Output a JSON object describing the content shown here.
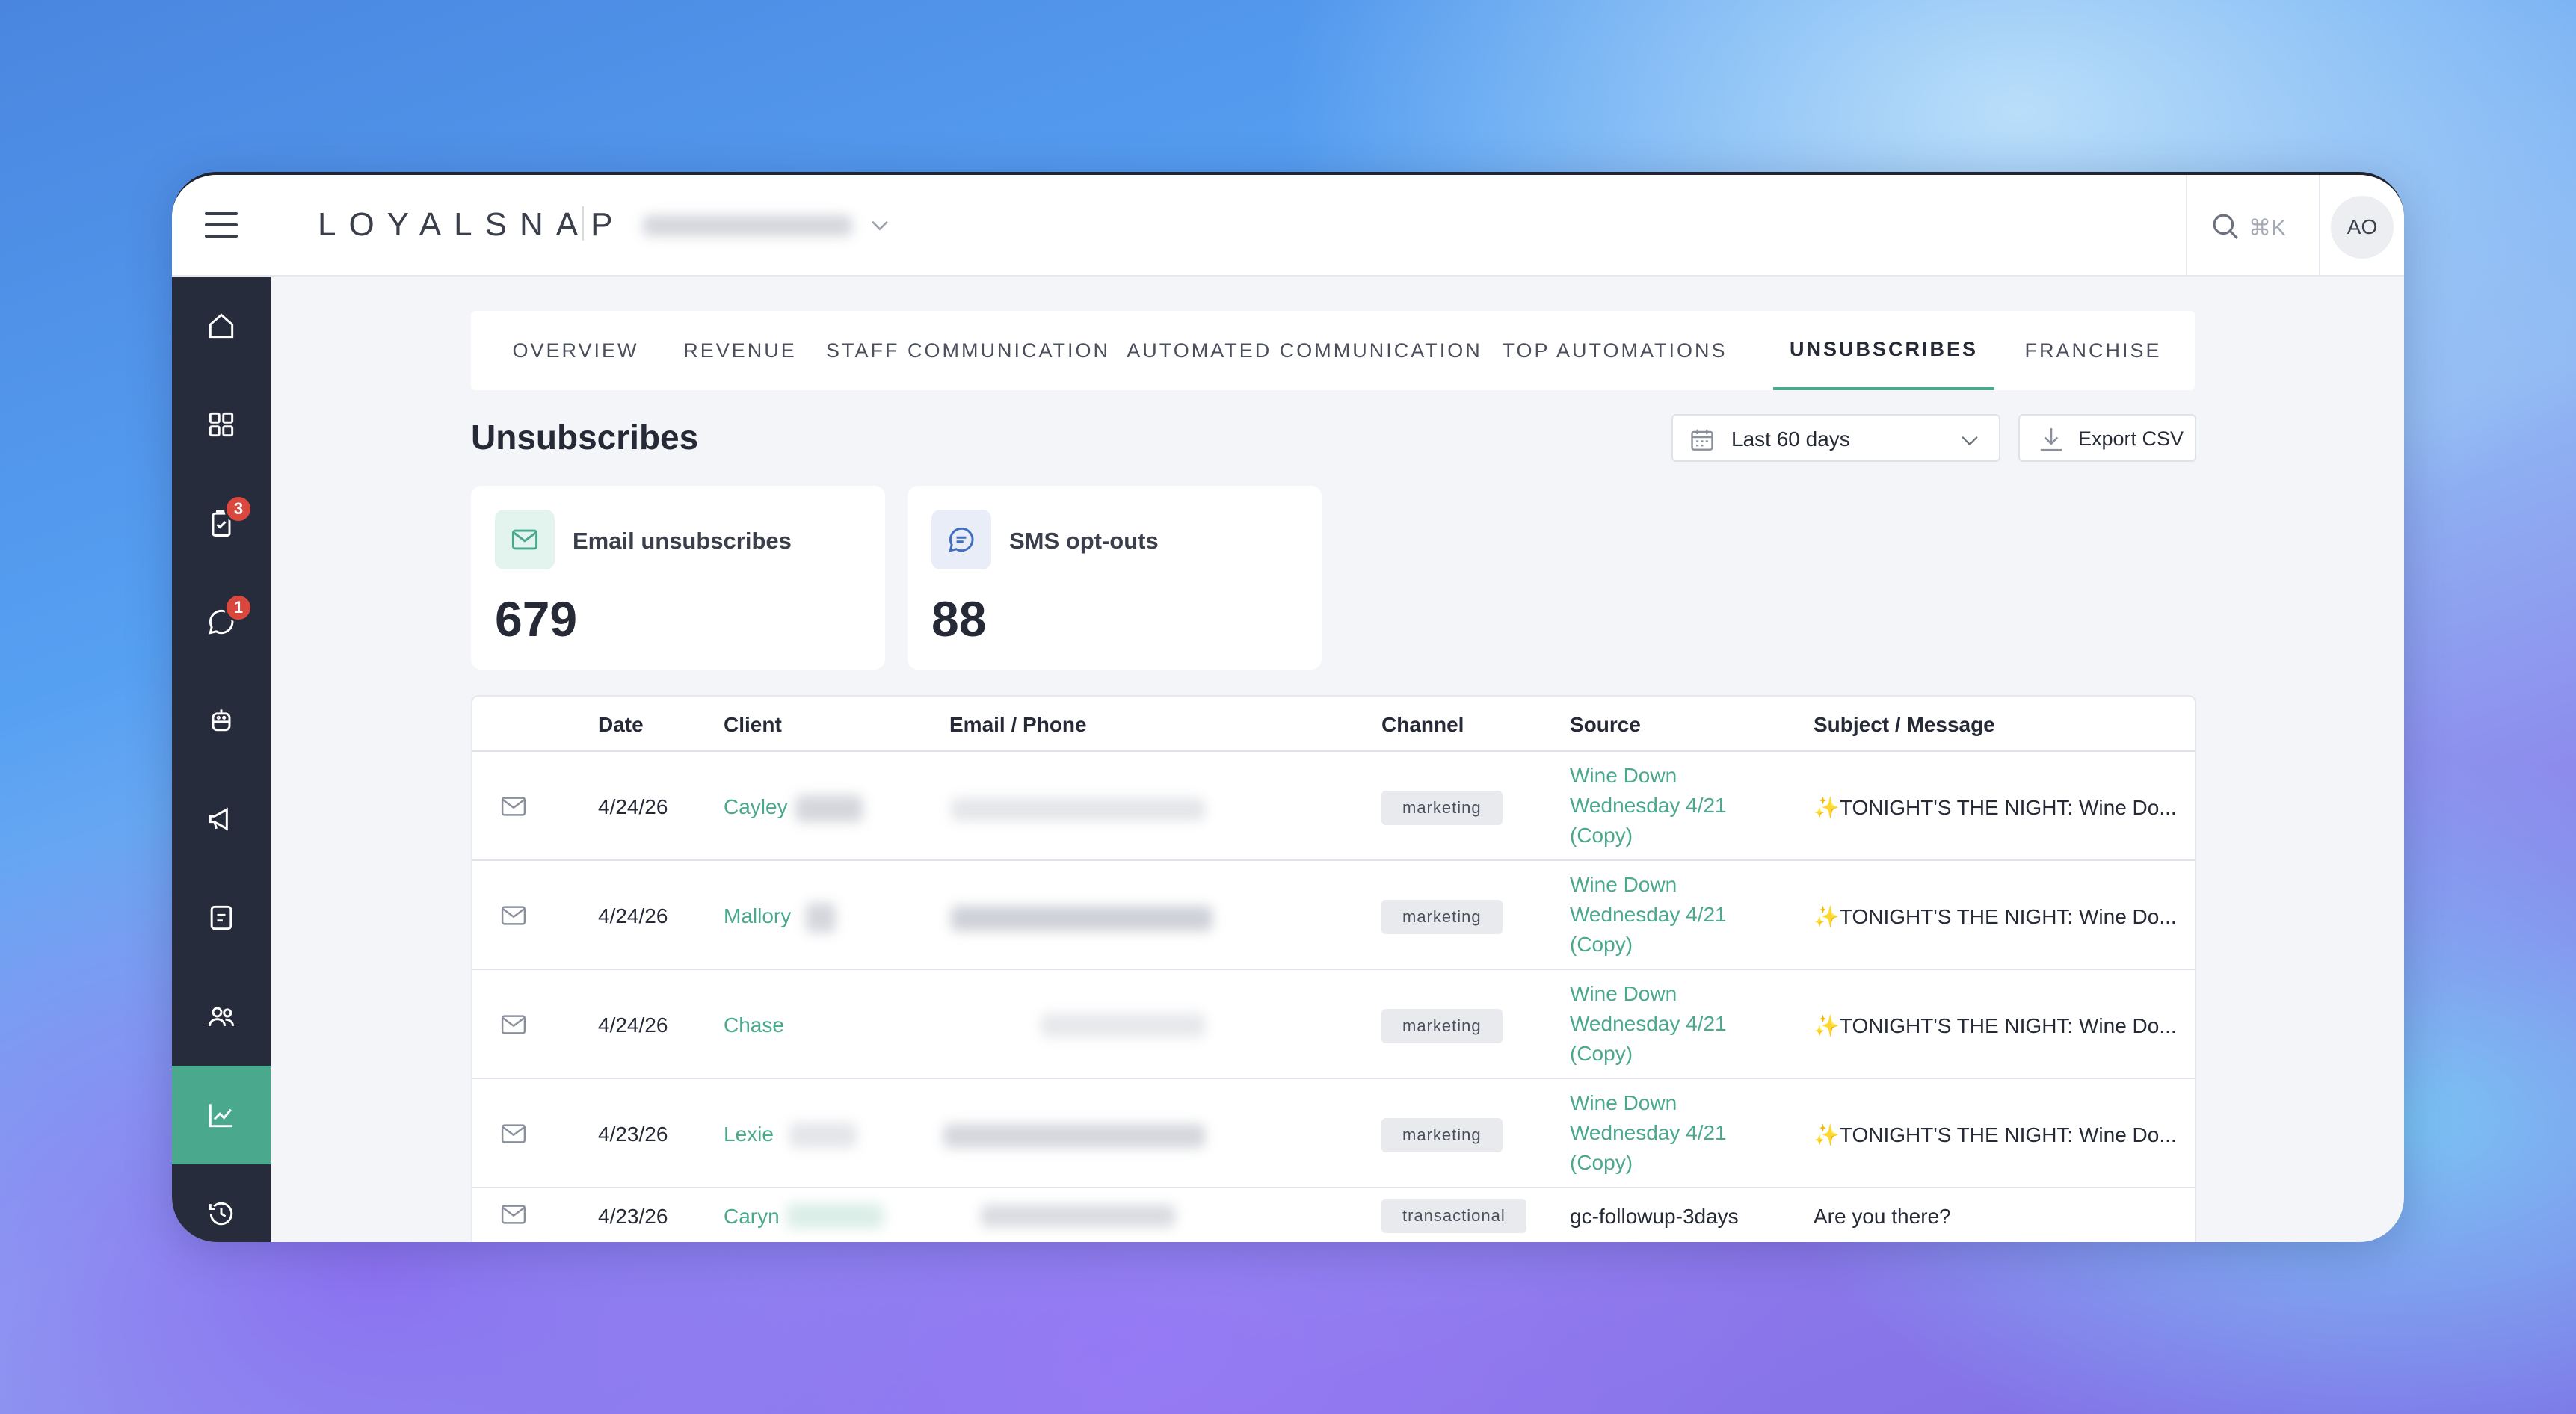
{
  "app": {
    "logo": "LOYALSNAP",
    "search_shortcut": "⌘K",
    "avatar_initials": "AO"
  },
  "sidebar": {
    "items": [
      {
        "icon": "home-icon"
      },
      {
        "icon": "grid-icon"
      },
      {
        "icon": "clipboard-check-icon",
        "badge": "3"
      },
      {
        "icon": "chat-icon",
        "badge": "1"
      },
      {
        "icon": "robot-icon"
      },
      {
        "icon": "megaphone-icon"
      },
      {
        "icon": "note-icon"
      },
      {
        "icon": "users-icon"
      },
      {
        "icon": "chart-line-icon",
        "active": true
      },
      {
        "icon": "history-icon"
      }
    ]
  },
  "tabs": [
    {
      "label": "OVERVIEW"
    },
    {
      "label": "REVENUE"
    },
    {
      "label": "STAFF COMMUNICATION"
    },
    {
      "label": "AUTOMATED COMMUNICATION"
    },
    {
      "label": "TOP AUTOMATIONS"
    },
    {
      "label": "UNSUBSCRIBES",
      "active": true
    },
    {
      "label": "FRANCHISE"
    }
  ],
  "page": {
    "title": "Unsubscribes",
    "date_range": "Last 60 days",
    "export_label": "Export CSV"
  },
  "stats": [
    {
      "label": "Email unsubscribes",
      "value": "679",
      "icon": "mail-icon"
    },
    {
      "label": "SMS opt-outs",
      "value": "88",
      "icon": "chat-bubble-icon"
    }
  ],
  "table": {
    "columns": [
      "Date",
      "Client",
      "Email / Phone",
      "Channel",
      "Source",
      "Subject / Message"
    ],
    "rows": [
      {
        "date": "4/24/26",
        "client": "Cayley",
        "channel": "marketing",
        "source": "Wine Down Wednesday 4/21 (Copy)",
        "subject": "TONIGHT'S THE NIGHT: Wine Do..."
      },
      {
        "date": "4/24/26",
        "client": "Mallory",
        "channel": "marketing",
        "source": "Wine Down Wednesday 4/21 (Copy)",
        "subject": "TONIGHT'S THE NIGHT: Wine Do..."
      },
      {
        "date": "4/24/26",
        "client": "Chase",
        "channel": "marketing",
        "source": "Wine Down Wednesday 4/21 (Copy)",
        "subject": "TONIGHT'S THE NIGHT: Wine Do..."
      },
      {
        "date": "4/23/26",
        "client": "Lexie",
        "channel": "marketing",
        "source": "Wine Down Wednesday 4/21 (Copy)",
        "subject": "TONIGHT'S THE NIGHT: Wine Do..."
      },
      {
        "date": "4/23/26",
        "client": "Caryn",
        "channel": "transactional",
        "source": "gc-followup-3days",
        "subject": "Are you there?"
      }
    ]
  },
  "colors": {
    "accent": "#4aa88d",
    "sidebar": "#272c3c",
    "badge": "#d9473d"
  }
}
